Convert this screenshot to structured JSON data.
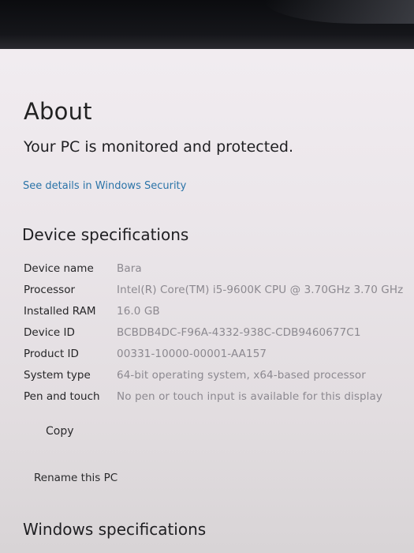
{
  "about": {
    "title": "About",
    "status_message": "Your PC is monitored and protected.",
    "security_link": "See details in Windows Security"
  },
  "device_specifications": {
    "heading": "Device specifications",
    "rows": [
      {
        "label": "Device name",
        "value": "Bara"
      },
      {
        "label": "Processor",
        "value": "Intel(R) Core(TM) i5-9600K CPU @ 3.70GHz   3.70 GHz"
      },
      {
        "label": "Installed RAM",
        "value": "16.0 GB"
      },
      {
        "label": "Device ID",
        "value": "BCBDB4DC-F96A-4332-938C-CDB9460677C1"
      },
      {
        "label": "Product ID",
        "value": "00331-10000-00001-AA157"
      },
      {
        "label": "System type",
        "value": "64-bit operating system, x64-based processor"
      },
      {
        "label": "Pen and touch",
        "value": "No pen or touch input is available for this display"
      }
    ],
    "copy_label": "Copy",
    "rename_label": "Rename this PC"
  },
  "windows_specifications": {
    "heading": "Windows specifications"
  }
}
